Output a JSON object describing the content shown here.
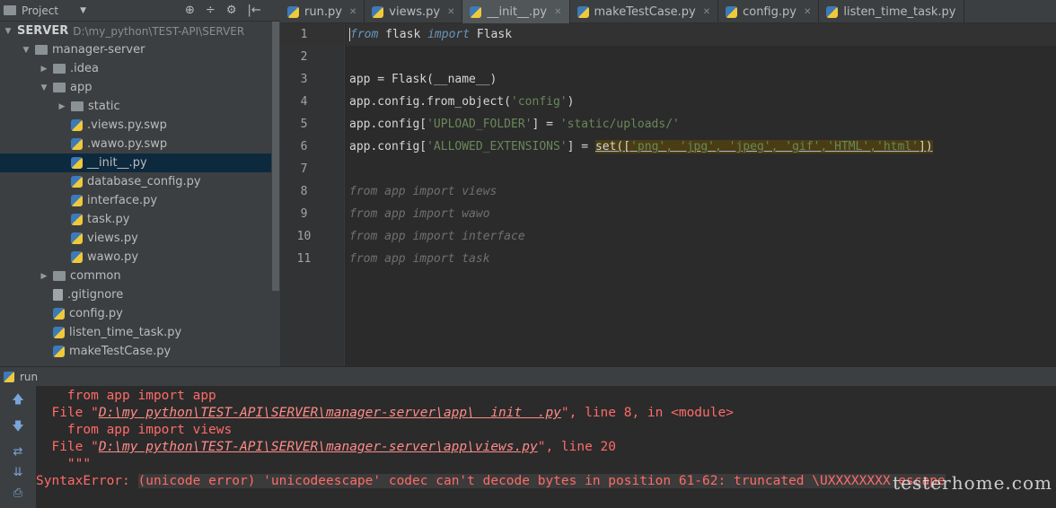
{
  "project_bar": {
    "title": "Project",
    "dropdown": "▼",
    "tools": [
      "⊕",
      "÷",
      "⚙",
      "|←"
    ]
  },
  "tabs": [
    {
      "label": "run.py",
      "active": false
    },
    {
      "label": "views.py",
      "active": false
    },
    {
      "label": "__init__.py",
      "active": true
    },
    {
      "label": "makeTestCase.py",
      "active": false
    },
    {
      "label": "config.py",
      "active": false
    },
    {
      "label": "listen_time_task.py",
      "active": false
    }
  ],
  "tree": {
    "root_name": "SERVER",
    "root_path": "D:\\my_python\\TEST-API\\SERVER",
    "items": [
      {
        "label": "manager-server",
        "arrow": "▼",
        "icon": "folder",
        "indent": 1
      },
      {
        "label": ".idea",
        "arrow": "▶",
        "icon": "folder",
        "indent": 2
      },
      {
        "label": "app",
        "arrow": "▼",
        "icon": "folder",
        "indent": 2
      },
      {
        "label": "static",
        "arrow": "▶",
        "icon": "folder",
        "indent": 3
      },
      {
        "label": ".views.py.swp",
        "arrow": "",
        "icon": "py",
        "indent": 3
      },
      {
        "label": ".wawo.py.swp",
        "arrow": "",
        "icon": "py",
        "indent": 3
      },
      {
        "label": "__init__.py",
        "arrow": "",
        "icon": "py",
        "indent": 3,
        "selected": true
      },
      {
        "label": "database_config.py",
        "arrow": "",
        "icon": "py",
        "indent": 3
      },
      {
        "label": "interface.py",
        "arrow": "",
        "icon": "py",
        "indent": 3
      },
      {
        "label": "task.py",
        "arrow": "",
        "icon": "py",
        "indent": 3
      },
      {
        "label": "views.py",
        "arrow": "",
        "icon": "py",
        "indent": 3
      },
      {
        "label": "wawo.py",
        "arrow": "",
        "icon": "py",
        "indent": 3
      },
      {
        "label": "common",
        "arrow": "▶",
        "icon": "folder",
        "indent": 2
      },
      {
        "label": ".gitignore",
        "arrow": "",
        "icon": "file",
        "indent": 2
      },
      {
        "label": "config.py",
        "arrow": "",
        "icon": "py",
        "indent": 2
      },
      {
        "label": "listen_time_task.py",
        "arrow": "",
        "icon": "py",
        "indent": 2
      },
      {
        "label": "makeTestCase.py",
        "arrow": "",
        "icon": "py",
        "indent": 2
      }
    ]
  },
  "editor": {
    "line_numbers": [
      "1",
      "2",
      "3",
      "4",
      "5",
      "6",
      "7",
      "8",
      "9",
      "10",
      "11"
    ],
    "l1": {
      "from": "from",
      "mod": " flask ",
      "imp": "import",
      "name": " Flask"
    },
    "l3": "app = Flask(__name__)",
    "l4": {
      "a": "app.config.from_object(",
      "s": "'config'",
      "b": ")"
    },
    "l5": {
      "a": "app.config[",
      "s1": "'UPLOAD_FOLDER'",
      "b": "] = ",
      "s2": "'static/uploads/'"
    },
    "l6": {
      "a": "app.config[",
      "s1": "'ALLOWED_EXTENSIONS'",
      "b": "] = ",
      "c": "set([",
      "s2": "'png', 'jpg', 'jpeg', 'gif','HTML','html'",
      "d": "])"
    },
    "l8": "from app import views",
    "l9": "from app import wawo",
    "l10": "from app import interface",
    "l11": "from app import task"
  },
  "run_bar": {
    "label": "run"
  },
  "console": {
    "lines": [
      "    from app import app",
      "  File \"",
      "    from app import views",
      "  File \"",
      "    \"\"\"",
      "SyntaxError: "
    ],
    "link1": "D:\\my python\\TEST-API\\SERVER\\manager-server\\app\\  init  .py",
    "tail1": "\", line 8, in <module>",
    "link2": "D:\\my python\\TEST-API\\SERVER\\manager-server\\app\\views.py",
    "tail2": "\", line 20",
    "error": "(unicode error) 'unicodeescape' codec can't decode bytes in position 61-62: truncated \\UXXXXXXXX escape"
  },
  "watermark": "testerhome.com"
}
